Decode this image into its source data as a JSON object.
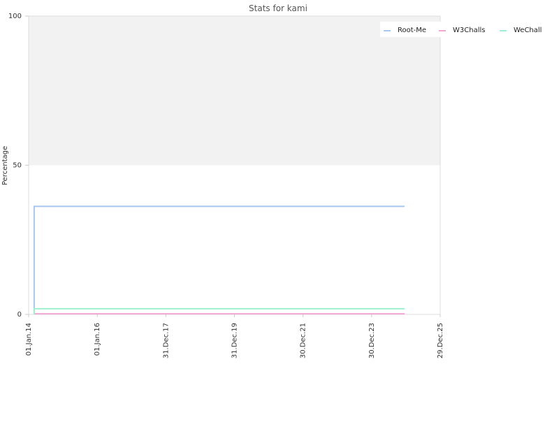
{
  "chart_data": {
    "type": "line",
    "title": "Stats for kami",
    "xlabel": "",
    "ylabel": "Percentage",
    "x_tick_labels": [
      "01.Jan.14",
      "01.Jan.16",
      "31.Dec.17",
      "31.Dec.19",
      "30.Dec.21",
      "30.Dec.23",
      "29.Dec.25"
    ],
    "y_tick_labels": [
      "0",
      "50",
      "100"
    ],
    "xlim": [
      "2014-01-01",
      "2025-12-29"
    ],
    "ylim": [
      0,
      100
    ],
    "shaded_region": {
      "from": 50,
      "to": 100,
      "color": "#f2f2f2"
    },
    "grid": false,
    "legend_position": "top-right",
    "series": [
      {
        "name": "Root-Me",
        "color": "#a6c8f0",
        "points": [
          [
            "2014-03-01",
            0
          ],
          [
            "2014-03-01",
            36.2
          ],
          [
            "2024-12-15",
            36.2
          ]
        ]
      },
      {
        "name": "W3Challs",
        "color": "#f3a7d3",
        "points": [
          [
            "2014-03-01",
            0.2
          ],
          [
            "2024-12-15",
            0.2
          ]
        ]
      },
      {
        "name": "WeChall",
        "color": "#9ff0cf",
        "points": [
          [
            "2014-03-01",
            0
          ],
          [
            "2014-03-01",
            1.9
          ],
          [
            "2024-12-15",
            1.9
          ]
        ]
      }
    ]
  }
}
